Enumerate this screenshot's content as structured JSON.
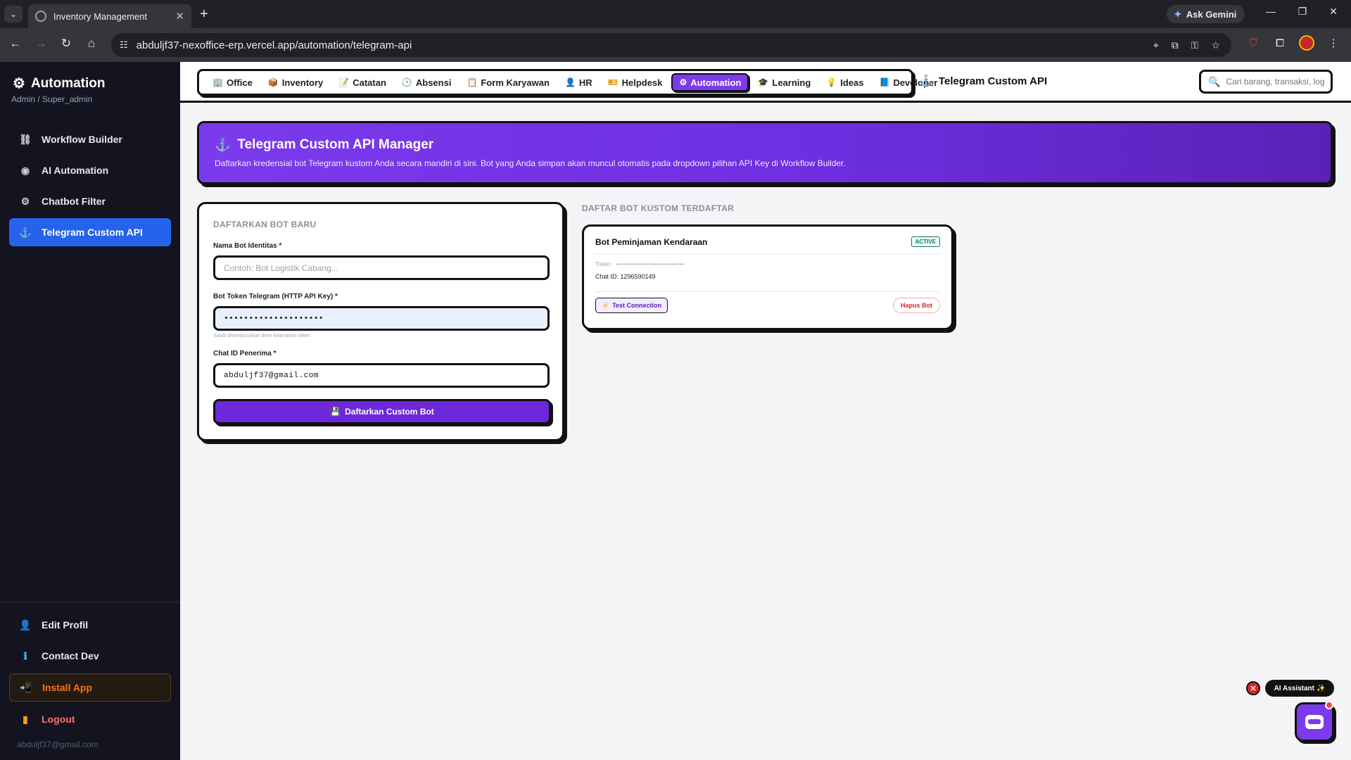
{
  "browser": {
    "tab_title": "Inventory Management",
    "tab_close": "✕",
    "new_tab": "+",
    "url": "abduljf37-nexoffice-erp.vercel.app/automation/telegram-api",
    "gemini_label": "Ask Gemini",
    "minimize": "—",
    "restore": "❐",
    "close": "✕"
  },
  "sidebar": {
    "title": "Automation",
    "subtitle": "Admin / Super_admin",
    "items": [
      {
        "label": "Workflow Builder",
        "icon": "workflow-icon",
        "glyph": "⛓"
      },
      {
        "label": "AI Automation",
        "icon": "robot-icon",
        "glyph": "◉"
      },
      {
        "label": "Chatbot Filter",
        "icon": "gear-icon",
        "glyph": "⚙"
      },
      {
        "label": "Telegram Custom API",
        "icon": "anchor-icon",
        "glyph": "⚓"
      }
    ],
    "bottom": [
      {
        "label": "Edit Profil",
        "icon": "user-icon",
        "glyph": "👤"
      },
      {
        "label": "Contact Dev",
        "icon": "info-icon",
        "glyph": "ℹ"
      },
      {
        "label": "Install App",
        "icon": "install-icon",
        "glyph": "📲"
      },
      {
        "label": "Logout",
        "icon": "logout-icon",
        "glyph": "▮"
      }
    ],
    "email": "abduljf37@gmail.com"
  },
  "topnav": {
    "items": [
      {
        "label": "Office",
        "glyph": "🏢"
      },
      {
        "label": "Inventory",
        "glyph": "📦"
      },
      {
        "label": "Catatan",
        "glyph": "📝"
      },
      {
        "label": "Absensi",
        "glyph": "🕒"
      },
      {
        "label": "Form Karyawan",
        "glyph": "📋"
      },
      {
        "label": "HR",
        "glyph": "👤"
      },
      {
        "label": "Helpdesk",
        "glyph": "🎫"
      },
      {
        "label": "Automation",
        "glyph": "⚙"
      },
      {
        "label": "Learning",
        "glyph": "🎓"
      },
      {
        "label": "Ideas",
        "glyph": "💡"
      },
      {
        "label": "Developer",
        "glyph": "📘"
      }
    ],
    "active": "Automation",
    "page_title": "Telegram Custom API",
    "search_placeholder": "Cari barang, transaksi, log..."
  },
  "banner": {
    "title": "Telegram Custom API Manager",
    "description": "Daftarkan kredensial bot Telegram kustom Anda secara mandiri di sini. Bot yang Anda simpan akan muncul otomatis pada dropdown pilihan API Key di Workflow Builder."
  },
  "form": {
    "section_title": "DAFTARKAN BOT BARU",
    "name_label": "Nama Bot Identitas *",
    "name_placeholder": "Contoh: Bot Logistik Cabang...",
    "token_label": "Bot Token Telegram (HTTP API Key) *",
    "token_value": "••••••••••••••••••••",
    "token_hint": "Sandi disembunyikan demi keamanan token.",
    "chat_label": "Chat ID Penerima *",
    "chat_value": "abduljf37@gmail.com",
    "submit_label": "Daftarkan Custom Bot"
  },
  "bots": {
    "section_title": "DAFTAR BOT KUSTOM TERDAFTAR",
    "items": [
      {
        "name": "Bot Peminjaman Kendaraan",
        "status": "ACTIVE",
        "token_label": "Token:",
        "token_value": "•••••••••••••••••••••••••••",
        "chat_id": "Chat ID: 1296590149",
        "test_label": "Test Connection",
        "delete_label": "Hapus Bot"
      }
    ]
  },
  "assistant": {
    "label": "AI Assistant",
    "sparkle": "✨",
    "close": "✕"
  },
  "colors": {
    "accent": "#7c3aed",
    "sidebar_bg": "#13141f",
    "active_blue": "#2563eb",
    "install_orange": "#f97316",
    "logout_red": "#f87171"
  }
}
